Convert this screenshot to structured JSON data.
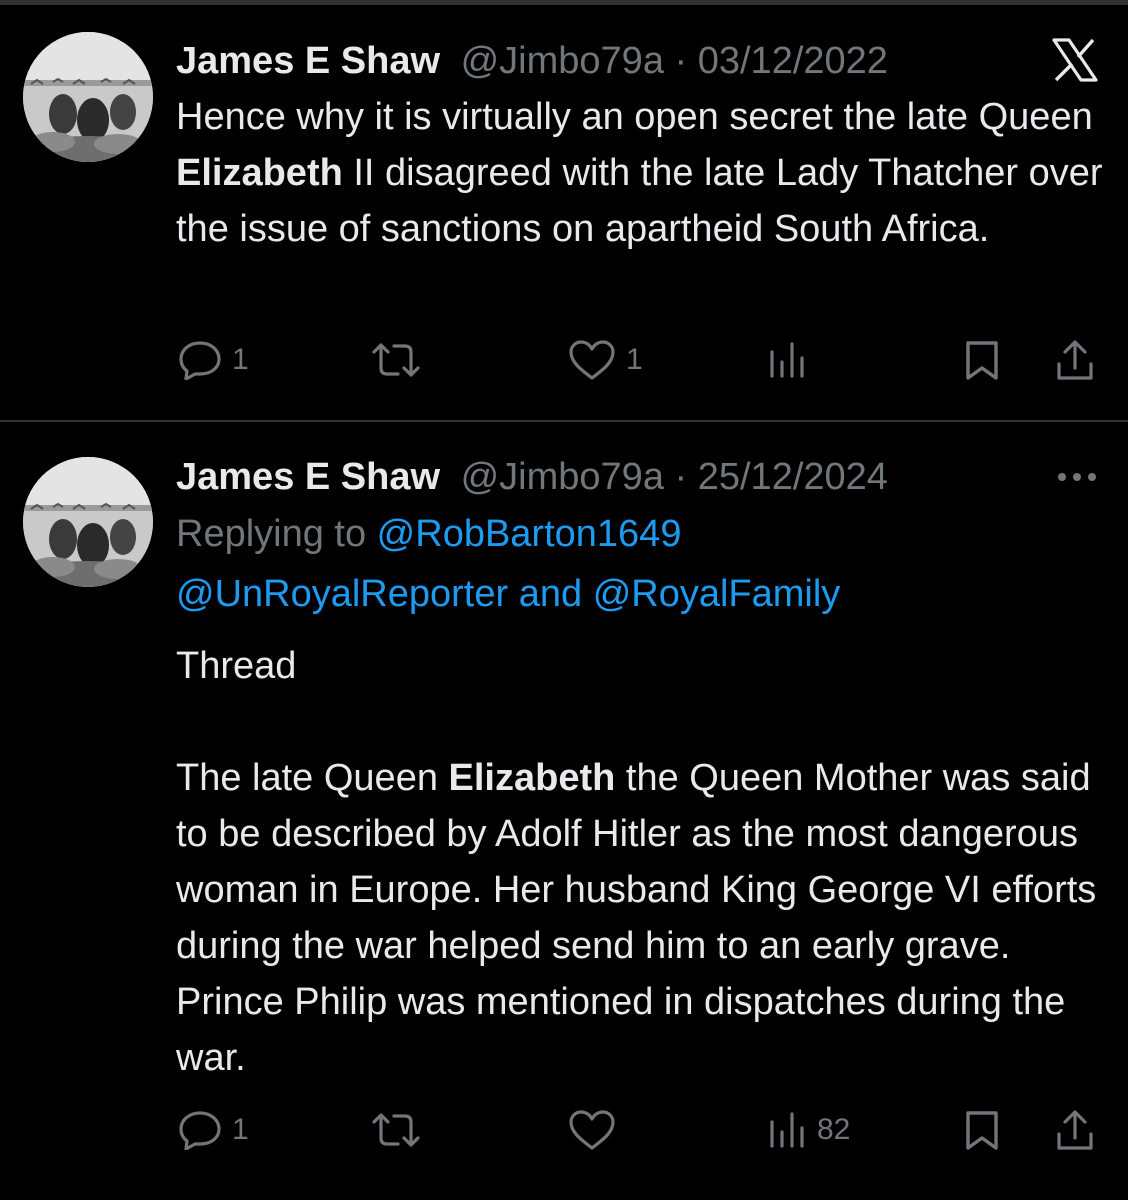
{
  "tweets": [
    {
      "name": "James E Shaw",
      "handle": "@Jimbo79a",
      "separator": "·",
      "date": "03/12/2022",
      "corner_icon": "x-logo-icon",
      "text_parts": [
        "Hence why it is virtually an open secret the late Queen ",
        "Elizabeth",
        " II disagreed with the late Lady Thatcher over the issue of sanctions on apartheid South Africa."
      ],
      "actions": {
        "reply": "1",
        "retweet": "",
        "like": "1",
        "views": "",
        "bookmark": "",
        "share": ""
      }
    },
    {
      "name": "James E Shaw",
      "handle": "@Jimbo79a",
      "separator": "·",
      "date": "25/12/2024",
      "corner_icon": "more-icon",
      "replying_prefix": "Replying to ",
      "replying_to_1": "@RobBarton1649",
      "replying_to_2": "@UnRoyalReporter",
      "replying_and": " and ",
      "replying_to_3": "@RoyalFamily",
      "thread_label": "Thread",
      "text_parts": [
        "The late Queen ",
        "Elizabeth",
        " the Queen Mother was said to be described by Adolf Hitler as the most dangerous woman in Europe. Her husband King George VI efforts during the war helped send him to an early grave. Prince Philip was mentioned in dispatches during the war."
      ],
      "actions": {
        "reply": "1",
        "retweet": "",
        "like": "",
        "views": "82",
        "bookmark": "",
        "share": ""
      }
    }
  ],
  "colors": {
    "background": "#000000",
    "text": "#e7e9ea",
    "muted": "#71767b",
    "link": "#1d9bf0",
    "divider": "#2f3336"
  }
}
